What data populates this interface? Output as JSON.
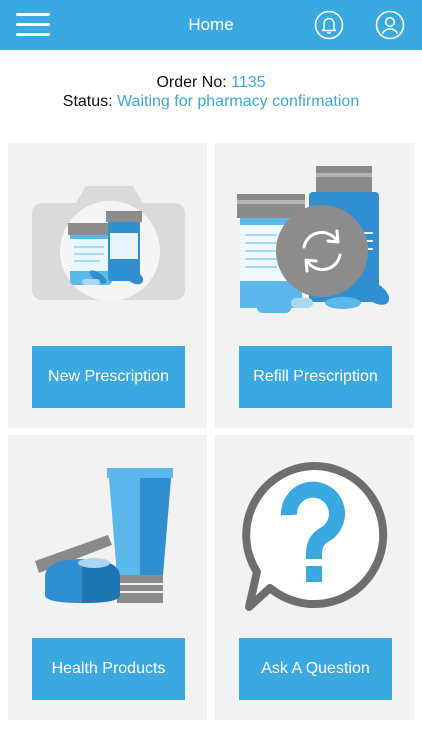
{
  "header": {
    "title": "Home",
    "menu_icon": "hamburger-menu-icon",
    "bell_icon": "bell-icon",
    "profile_icon": "user-profile-icon"
  },
  "order": {
    "label": "Order No:",
    "number": "1135",
    "status_label": "Status:",
    "status_value": "Waiting for pharmacy confirmation"
  },
  "cards": [
    {
      "label": "New Prescription",
      "icon": "camera-medicine-icon"
    },
    {
      "label": "Refill Prescription",
      "icon": "refill-medicine-icon"
    },
    {
      "label": "Health Products",
      "icon": "health-products-icon"
    },
    {
      "label": "Ask A Question",
      "icon": "question-bubble-icon"
    }
  ],
  "colors": {
    "accent": "#3aa8e1",
    "card_bg": "#f2f2f2"
  }
}
